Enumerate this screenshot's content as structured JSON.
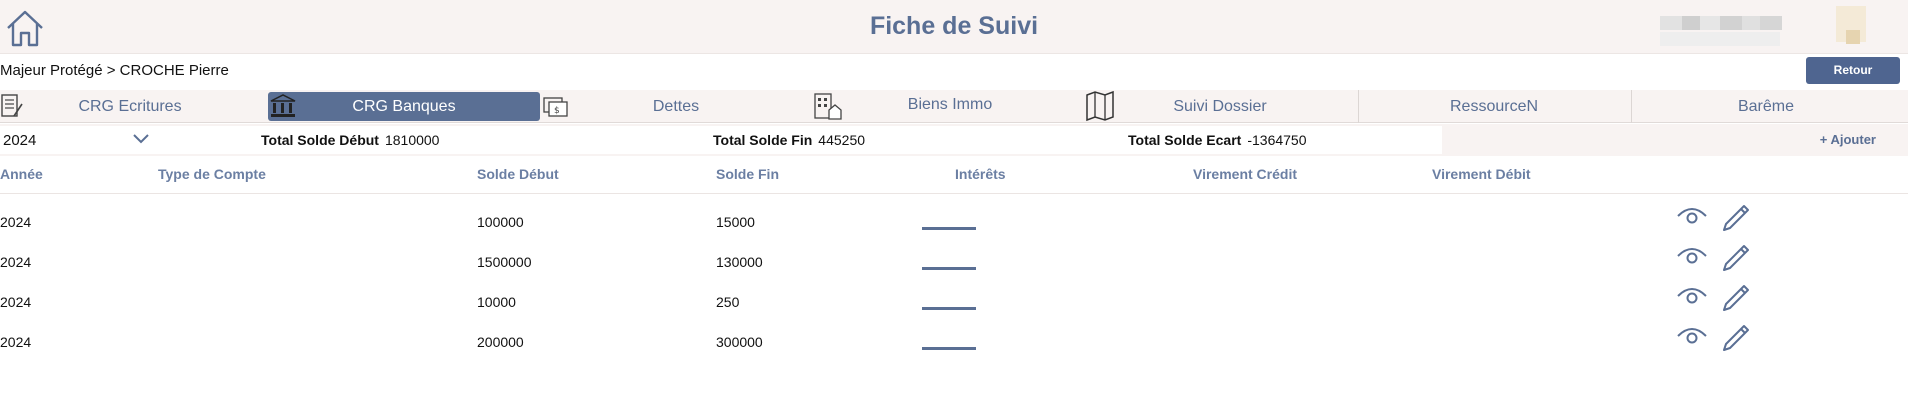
{
  "header": {
    "title": "Fiche de Suivi"
  },
  "breadcrumb": "Majeur Protégé > CROCHE Pierre",
  "back_label": "Retour",
  "tabs": [
    {
      "label": "CRG Ecritures",
      "active": false
    },
    {
      "label": "CRG Banques",
      "active": true
    },
    {
      "label": "Dettes",
      "active": false
    },
    {
      "label": "Biens Immo",
      "active": false
    },
    {
      "label": "Suivi Dossier",
      "active": false
    },
    {
      "label": "RessourceN",
      "active": false
    },
    {
      "label": "Barême",
      "active": false
    }
  ],
  "filters": {
    "year": "2024"
  },
  "totals": {
    "debut_label": "Total Solde Début",
    "debut_value": "1810000",
    "fin_label": "Total Solde Fin",
    "fin_value": "445250",
    "ecart_label": "Total Solde Ecart",
    "ecart_value": "-1364750"
  },
  "add_label": "+ Ajouter",
  "table": {
    "columns": [
      "Année",
      "Type de Compte",
      "Solde Début",
      "Solde Fin",
      "Intérêts",
      "Virement Crédit",
      "Virement Débit"
    ],
    "rows": [
      {
        "annee": "2024",
        "type": "",
        "debut": "100000",
        "fin": "15000",
        "interets": "",
        "credit": "",
        "debit": ""
      },
      {
        "annee": "2024",
        "type": "",
        "debut": "1500000",
        "fin": "130000",
        "interets": "",
        "credit": "",
        "debit": ""
      },
      {
        "annee": "2024",
        "type": "",
        "debut": "10000",
        "fin": "250",
        "interets": "",
        "credit": "",
        "debit": ""
      },
      {
        "annee": "2024",
        "type": "",
        "debut": "200000",
        "fin": "300000",
        "interets": "",
        "credit": "",
        "debit": ""
      }
    ]
  },
  "colors": {
    "accent": "#5a6f94",
    "header_bg": "#f8f3f2",
    "button": "#4f6590"
  },
  "icons": [
    "home-icon",
    "chevron-down-icon",
    "eye-icon",
    "pencil-icon",
    "ledger-icon",
    "bank-icon",
    "debt-icon",
    "building-icon",
    "map-icon"
  ]
}
